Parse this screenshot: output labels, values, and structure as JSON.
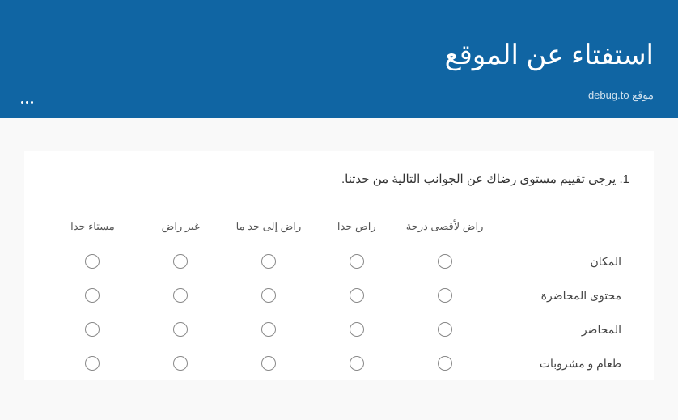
{
  "header": {
    "title": "استفتاء عن الموقع",
    "subtitle": "موقع debug.to"
  },
  "question": {
    "number": "1.",
    "text": "يرجى تقييم مستوى رضاك عن الجوانب التالية من حدثنا."
  },
  "columns": [
    "راض لأقصى درجة",
    "راض جدا",
    "راض إلى حد ما",
    "غير راض",
    "مستاء جدا"
  ],
  "rows": [
    "المكان",
    "محتوى المحاضرة",
    "المحاضر",
    "طعام و مشروبات"
  ]
}
